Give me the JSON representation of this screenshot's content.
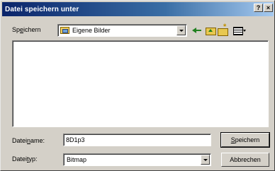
{
  "window": {
    "title": "Datei speichern unter",
    "help_label": "?",
    "close_label": "×"
  },
  "lookin": {
    "label_mnemonic": "e",
    "label_pre": "Sp",
    "label_post": "ichern",
    "value": "Eigene Bilder"
  },
  "toolbar": {
    "icons": [
      "back-icon",
      "up-folder-icon",
      "new-folder-icon",
      "view-menu-icon"
    ]
  },
  "filename": {
    "label_pre": "Datei",
    "label_mnemonic": "n",
    "label_post": "ame:",
    "value": "8D1p3"
  },
  "filetype": {
    "label_pre": "Datei",
    "label_mnemonic": "t",
    "label_post": "yp:",
    "value": "Bitmap"
  },
  "buttons": {
    "save_mnemonic": "S",
    "save_rest": "peichern",
    "cancel_label": "Abbrechen"
  }
}
